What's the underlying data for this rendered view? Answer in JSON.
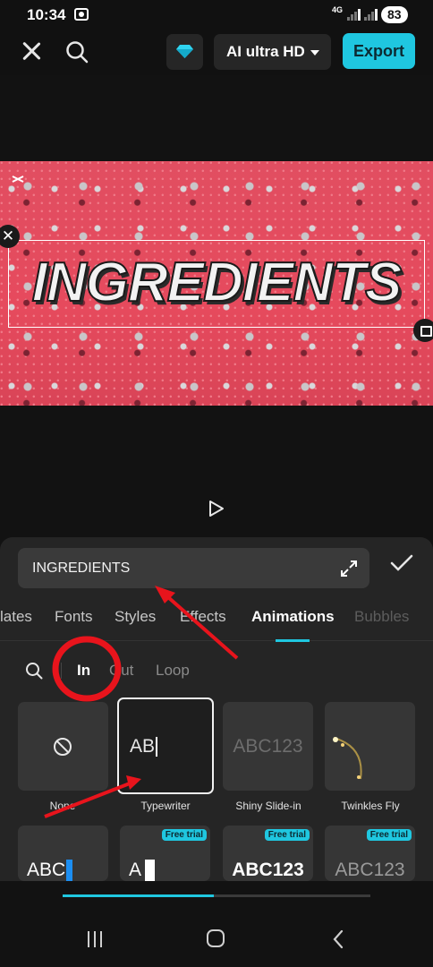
{
  "status_bar": {
    "time": "10:34",
    "network": "4G",
    "battery": "83"
  },
  "toolbar": {
    "quality_label": "AI ultra HD",
    "export_label": "Export"
  },
  "preview": {
    "overlay_text": "INGREDIENTS"
  },
  "editor": {
    "text_value": "INGREDIENTS",
    "tabs": [
      {
        "label": "lates"
      },
      {
        "label": "Fonts"
      },
      {
        "label": "Styles"
      },
      {
        "label": "Effects"
      },
      {
        "label": "Animations",
        "active": true
      },
      {
        "label": "Bubbles"
      }
    ],
    "subtabs": [
      {
        "label": "In",
        "active": true
      },
      {
        "label": "Out"
      },
      {
        "label": "Loop"
      }
    ]
  },
  "animations": [
    {
      "label": "None",
      "preview": ""
    },
    {
      "label": "Typewriter",
      "preview": "AB",
      "selected": true
    },
    {
      "label": "Shiny Slide-in",
      "preview": "ABC123"
    },
    {
      "label": "Twinkles Fly",
      "preview": ""
    },
    {
      "label": "",
      "preview": "ABC"
    },
    {
      "label": "",
      "preview": "A",
      "badge": "Free trial"
    },
    {
      "label": "",
      "preview": "ABC123",
      "badge": "Free trial"
    },
    {
      "label": "",
      "preview": "ABC123",
      "badge": "Free trial"
    }
  ],
  "timeline": {
    "progress": 0.49
  },
  "colors": {
    "accent": "#1fc7e0",
    "annotation": "#e8141c"
  }
}
